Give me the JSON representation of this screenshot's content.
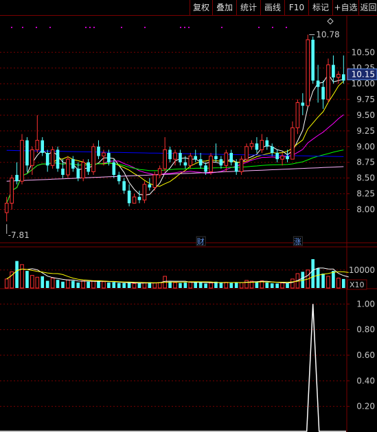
{
  "toolbar": {
    "buttons": [
      "复权",
      "叠加",
      "统计",
      "画线",
      "F10",
      "标记",
      "+自选",
      "返回"
    ]
  },
  "colors": {
    "up": "#ff3232",
    "down": "#54ffff",
    "ma5": "#ffffff",
    "ma10": "#ffff00",
    "ma20": "#ff00ff",
    "ma60": "#00ff00",
    "ma120": "#ffb4ff",
    "ma250": "#0000ff",
    "grid": "#7a0000",
    "axis_text": "#c8c8c8",
    "event_text": "#6495ed"
  },
  "chart_data": [
    {
      "type": "candlestick",
      "ylim": [
        7.7,
        10.95
      ],
      "y_ticks": [
        "10.50",
        "10.25",
        "10.00",
        "9.75",
        "9.50",
        "9.25",
        "9.00",
        "8.75",
        "8.50",
        "8.25",
        "8.00"
      ],
      "y_tick_values": [
        10.5,
        10.25,
        10.0,
        9.75,
        9.5,
        9.25,
        9.0,
        8.75,
        8.5,
        8.25,
        8.0
      ],
      "current_price_label": "10.15",
      "current_price": 10.15,
      "high_label": "10.78",
      "high_value": 10.78,
      "low_label": "7.81",
      "low_value": 7.81,
      "events": [
        {
          "label": "财",
          "index": 38
        },
        {
          "label": "涨",
          "index": 57
        }
      ],
      "candles": [
        {
          "o": 7.95,
          "h": 8.2,
          "l": 7.81,
          "c": 8.1
        },
        {
          "o": 8.1,
          "h": 8.55,
          "l": 8.0,
          "c": 8.5
        },
        {
          "o": 8.55,
          "h": 8.75,
          "l": 8.4,
          "c": 8.45
        },
        {
          "o": 8.45,
          "h": 9.2,
          "l": 8.4,
          "c": 9.1
        },
        {
          "o": 9.1,
          "h": 9.15,
          "l": 8.6,
          "c": 8.7
        },
        {
          "o": 8.7,
          "h": 9.0,
          "l": 8.55,
          "c": 8.95
        },
        {
          "o": 8.95,
          "h": 9.5,
          "l": 8.9,
          "c": 9.1
        },
        {
          "o": 9.1,
          "h": 9.15,
          "l": 8.85,
          "c": 8.9
        },
        {
          "o": 8.9,
          "h": 8.95,
          "l": 8.6,
          "c": 8.7
        },
        {
          "o": 8.7,
          "h": 9.0,
          "l": 8.65,
          "c": 8.95
        },
        {
          "o": 8.95,
          "h": 9.0,
          "l": 8.6,
          "c": 8.65
        },
        {
          "o": 8.65,
          "h": 8.8,
          "l": 8.5,
          "c": 8.55
        },
        {
          "o": 8.55,
          "h": 8.85,
          "l": 8.5,
          "c": 8.8
        },
        {
          "o": 8.8,
          "h": 8.85,
          "l": 8.6,
          "c": 8.65
        },
        {
          "o": 8.65,
          "h": 8.75,
          "l": 8.45,
          "c": 8.5
        },
        {
          "o": 8.5,
          "h": 8.8,
          "l": 8.45,
          "c": 8.75
        },
        {
          "o": 8.75,
          "h": 8.8,
          "l": 8.55,
          "c": 8.6
        },
        {
          "o": 8.6,
          "h": 9.05,
          "l": 8.55,
          "c": 9.0
        },
        {
          "o": 9.0,
          "h": 9.1,
          "l": 8.8,
          "c": 8.85
        },
        {
          "o": 8.85,
          "h": 8.95,
          "l": 8.7,
          "c": 8.9
        },
        {
          "o": 8.9,
          "h": 8.95,
          "l": 8.7,
          "c": 8.75
        },
        {
          "o": 8.75,
          "h": 8.8,
          "l": 8.5,
          "c": 8.55
        },
        {
          "o": 8.55,
          "h": 8.6,
          "l": 8.4,
          "c": 8.45
        },
        {
          "o": 8.45,
          "h": 8.5,
          "l": 8.25,
          "c": 8.3
        },
        {
          "o": 8.3,
          "h": 8.4,
          "l": 8.05,
          "c": 8.1
        },
        {
          "o": 8.1,
          "h": 8.25,
          "l": 8.1,
          "c": 8.2
        },
        {
          "o": 8.2,
          "h": 8.3,
          "l": 8.1,
          "c": 8.15
        },
        {
          "o": 8.15,
          "h": 8.45,
          "l": 8.1,
          "c": 8.4
        },
        {
          "o": 8.4,
          "h": 8.5,
          "l": 8.3,
          "c": 8.35
        },
        {
          "o": 8.35,
          "h": 8.6,
          "l": 8.3,
          "c": 8.55
        },
        {
          "o": 8.55,
          "h": 8.7,
          "l": 8.5,
          "c": 8.65
        },
        {
          "o": 8.65,
          "h": 9.15,
          "l": 8.6,
          "c": 8.95
        },
        {
          "o": 8.95,
          "h": 9.0,
          "l": 8.75,
          "c": 8.8
        },
        {
          "o": 8.8,
          "h": 8.95,
          "l": 8.7,
          "c": 8.9
        },
        {
          "o": 8.9,
          "h": 8.95,
          "l": 8.7,
          "c": 8.75
        },
        {
          "o": 8.75,
          "h": 8.85,
          "l": 8.65,
          "c": 8.7
        },
        {
          "o": 8.7,
          "h": 8.9,
          "l": 8.65,
          "c": 8.85
        },
        {
          "o": 8.85,
          "h": 8.95,
          "l": 8.75,
          "c": 8.8
        },
        {
          "o": 8.8,
          "h": 8.9,
          "l": 8.65,
          "c": 8.7
        },
        {
          "o": 8.7,
          "h": 8.75,
          "l": 8.55,
          "c": 8.6
        },
        {
          "o": 8.6,
          "h": 8.9,
          "l": 8.55,
          "c": 8.85
        },
        {
          "o": 8.85,
          "h": 9.05,
          "l": 8.75,
          "c": 8.8
        },
        {
          "o": 8.8,
          "h": 8.85,
          "l": 8.65,
          "c": 8.7
        },
        {
          "o": 8.7,
          "h": 8.95,
          "l": 8.6,
          "c": 8.9
        },
        {
          "o": 8.9,
          "h": 8.95,
          "l": 8.7,
          "c": 8.75
        },
        {
          "o": 8.75,
          "h": 8.8,
          "l": 8.55,
          "c": 8.6
        },
        {
          "o": 8.6,
          "h": 8.85,
          "l": 8.55,
          "c": 8.8
        },
        {
          "o": 8.8,
          "h": 9.05,
          "l": 8.75,
          "c": 9.0
        },
        {
          "o": 9.0,
          "h": 9.1,
          "l": 8.95,
          "c": 9.05
        },
        {
          "o": 9.05,
          "h": 9.15,
          "l": 8.9,
          "c": 8.95
        },
        {
          "o": 8.95,
          "h": 9.2,
          "l": 8.9,
          "c": 9.1
        },
        {
          "o": 9.1,
          "h": 9.15,
          "l": 8.95,
          "c": 9.0
        },
        {
          "o": 9.0,
          "h": 9.05,
          "l": 8.85,
          "c": 8.9
        },
        {
          "o": 8.9,
          "h": 8.95,
          "l": 8.75,
          "c": 8.8
        },
        {
          "o": 8.8,
          "h": 8.9,
          "l": 8.7,
          "c": 8.85
        },
        {
          "o": 8.85,
          "h": 8.95,
          "l": 8.75,
          "c": 8.8
        },
        {
          "o": 8.8,
          "h": 9.4,
          "l": 8.8,
          "c": 9.3
        },
        {
          "o": 9.3,
          "h": 9.75,
          "l": 9.2,
          "c": 9.7
        },
        {
          "o": 9.7,
          "h": 9.85,
          "l": 9.5,
          "c": 9.65
        },
        {
          "o": 9.65,
          "h": 10.78,
          "l": 9.65,
          "c": 10.7
        },
        {
          "o": 10.7,
          "h": 10.75,
          "l": 10.0,
          "c": 10.05
        },
        {
          "o": 10.05,
          "h": 10.3,
          "l": 9.7,
          "c": 9.95
        },
        {
          "o": 9.95,
          "h": 10.05,
          "l": 9.6,
          "c": 9.75
        },
        {
          "o": 9.75,
          "h": 10.4,
          "l": 9.7,
          "c": 10.3
        },
        {
          "o": 10.3,
          "h": 10.45,
          "l": 10.0,
          "c": 10.1
        },
        {
          "o": 10.1,
          "h": 10.2,
          "l": 10.0,
          "c": 10.15
        },
        {
          "o": 10.15,
          "h": 10.45,
          "l": 10.0,
          "c": 10.05
        }
      ]
    },
    {
      "type": "bar",
      "y_ticks": [
        "10000"
      ],
      "y_tick_values": [
        10000
      ],
      "ylim": [
        0,
        16000
      ],
      "multiplier_label": "X10",
      "values": [
        5000,
        9000,
        15000,
        13000,
        9500,
        7000,
        6000,
        6500,
        4000,
        5500,
        4500,
        3500,
        4500,
        4000,
        3000,
        4000,
        3500,
        4000,
        3800,
        3500,
        3000,
        3200,
        2800,
        2700,
        3000,
        2500,
        2600,
        3000,
        3200,
        2800,
        3000,
        6500,
        3500,
        3000,
        2800,
        3000,
        3500,
        3300,
        3000,
        2500,
        2800,
        3500,
        3000,
        3200,
        2800,
        3000,
        3000,
        4200,
        3800,
        3600,
        4000,
        3000,
        2600,
        2500,
        2800,
        2600,
        5000,
        8000,
        9000,
        10000,
        17500,
        11000,
        8000,
        6500,
        9500,
        5500,
        5000,
        4200
      ]
    },
    {
      "type": "line",
      "ylim": [
        0,
        1.05
      ],
      "y_ticks": [
        "1.00",
        "0.80",
        "0.60",
        "0.40",
        "0.20"
      ],
      "y_tick_values": [
        1.0,
        0.8,
        0.6,
        0.4,
        0.2
      ],
      "spike_index": 60,
      "spike_value": 1.0
    }
  ]
}
